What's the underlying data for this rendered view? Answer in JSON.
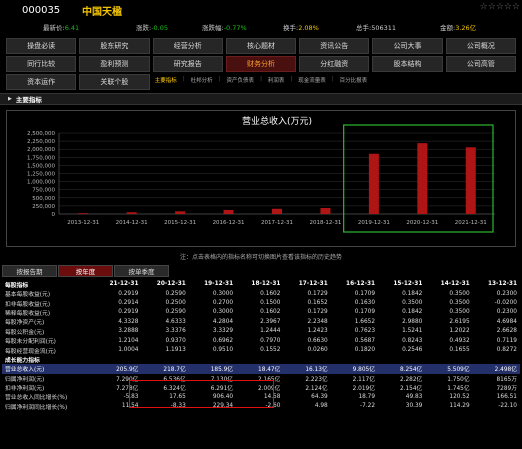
{
  "header": {
    "code": "000035",
    "name": "中国天楹",
    "stars": "☆☆☆☆☆"
  },
  "quote": {
    "last_price_label": "最新价:",
    "last_price": "6.41",
    "change_label": "涨跌:",
    "change": "-0.05",
    "pct_label": "涨跌幅:",
    "pct": "-0.77%",
    "turnover_label": "换手:",
    "turnover": "2.08%",
    "volume_label": "总手:",
    "volume": "506311",
    "amount_label": "金额:",
    "amount": "3.26亿"
  },
  "nav": [
    "操盘必读",
    "股东研究",
    "经营分析",
    "核心题材",
    "资讯公告",
    "公司大事",
    "公司概况",
    "同行比较",
    "盈利预测",
    "研究报告",
    "财务分析",
    "分红融资",
    "股本结构",
    "公司高管",
    "资本运作",
    "关联个股"
  ],
  "nav_active_index": 10,
  "subtabs": [
    "主要指标",
    "杜邦分析",
    "资产负债表",
    "利润表",
    "现金流量表",
    "百分比报表"
  ],
  "section_title": "主要指标",
  "chart_data": {
    "type": "bar",
    "title": "营业总收入(万元)",
    "categories": [
      "2013-12-31",
      "2014-12-31",
      "2015-12-31",
      "2016-12-31",
      "2017-12-31",
      "2018-12-31",
      "2019-12-31",
      "2020-12-31",
      "2021-12-31"
    ],
    "values": [
      25000,
      55000,
      82500,
      125000,
      161300,
      184700,
      1859300,
      2187000,
      2059000
    ],
    "yticks": [
      "0",
      "250,000",
      "500,000",
      "750,000",
      "1,000,000",
      "1,250,000",
      "1,500,000",
      "1,750,000",
      "2,000,000",
      "2,250,000",
      "2,500,000"
    ],
    "ylim": [
      0,
      2500000
    ],
    "bar_color": "#b01515",
    "highlight_color": "#2db82d"
  },
  "note": "注：点击表格内的指标名称可切换图片查看该指标的历史趋势",
  "tabs": [
    "按报告期",
    "按年度",
    "按单季度"
  ],
  "active_tab": 1,
  "table": {
    "columns": [
      "每股指标",
      "21-12-31",
      "20-12-31",
      "19-12-31",
      "18-12-31",
      "17-12-31",
      "16-12-31",
      "15-12-31",
      "14-12-31",
      "13-12-31"
    ],
    "rows": [
      {
        "label": "基本每股收益(元)",
        "values": [
          "0.2919",
          "0.2590",
          "0.3000",
          "0.1602",
          "0.1729",
          "0.1709",
          "0.1842",
          "0.3500",
          "0.2300"
        ]
      },
      {
        "label": "扣非每股收益(元)",
        "values": [
          "0.2914",
          "0.2500",
          "0.2700",
          "0.1500",
          "0.1652",
          "0.1630",
          "0.3500",
          "0.3500",
          "-0.0200"
        ]
      },
      {
        "label": "稀释每股收益(元)",
        "values": [
          "0.2919",
          "0.2590",
          "0.3000",
          "0.1602",
          "0.1729",
          "0.1709",
          "0.1842",
          "0.3500",
          "0.2300"
        ]
      },
      {
        "label": "每股净资产(元)",
        "values": [
          "4.3328",
          "4.6333",
          "4.2804",
          "2.3967",
          "2.2348",
          "1.6652",
          "2.9880",
          "2.6195",
          "4.6984"
        ]
      },
      {
        "label": "每股公积金(元)",
        "values": [
          "3.2888",
          "3.3376",
          "3.3329",
          "1.2444",
          "1.2423",
          "0.7623",
          "1.5241",
          "1.2022",
          "2.6628"
        ]
      },
      {
        "label": "每股未分配利润(元)",
        "values": [
          "1.2104",
          "0.9370",
          "0.6962",
          "0.7970",
          "0.6630",
          "0.5687",
          "0.8243",
          "0.4932",
          "0.7119"
        ]
      },
      {
        "label": "每股经营现金流(元)",
        "values": [
          "1.0004",
          "1.1913",
          "0.9510",
          "0.1552",
          "0.0260",
          "0.1820",
          "0.2546",
          "0.1655",
          "0.8272"
        ]
      }
    ],
    "group2": "成长能力指标",
    "rows2": [
      {
        "label": "营业总收入(元)",
        "values": [
          "205.9亿",
          "218.7亿",
          "185.9亿",
          "18.47亿",
          "16.13亿",
          "9.805亿",
          "8.254亿",
          "5.509亿",
          "2.498亿"
        ],
        "highlight": true
      },
      {
        "label": "归属净利润(元)",
        "values": [
          "7.290亿",
          "6.536亿",
          "7.130亿",
          "2.165亿",
          "2.223亿",
          "2.117亿",
          "2.282亿",
          "1.750亿",
          "8165万"
        ]
      },
      {
        "label": "扣非净利润(元)",
        "values": [
          "7.278亿",
          "6.324亿",
          "6.291亿",
          "2.009亿",
          "2.124亿",
          "2.019亿",
          "2.154亿",
          "1.745亿",
          "7289万"
        ]
      },
      {
        "label": "营业总收入同比增长(%)",
        "values": [
          "-5.83",
          "17.65",
          "906.40",
          "14.58",
          "64.39",
          "18.79",
          "49.83",
          "120.52",
          "166.51"
        ]
      },
      {
        "label": "归属净利润同比增长(%)",
        "values": [
          "11.54",
          "-8.33",
          "229.34",
          "-2.60",
          "4.98",
          "-7.22",
          "30.39",
          "114.29",
          "-22.10"
        ]
      }
    ]
  }
}
